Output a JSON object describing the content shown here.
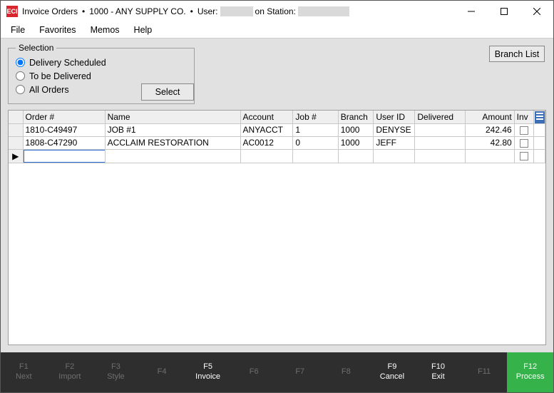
{
  "title": {
    "app_name": "Invoice Orders",
    "company": "1000 - ANY SUPPLY CO.",
    "user_prefix": "User:",
    "station_prefix": "on Station:"
  },
  "menu": {
    "file": "File",
    "favorites": "Favorites",
    "memos": "Memos",
    "help": "Help"
  },
  "selection": {
    "legend": "Selection",
    "opt_scheduled": "Delivery Scheduled",
    "opt_tobe": "To be Delivered",
    "opt_all": "All Orders",
    "select_btn": "Select"
  },
  "branch_btn": "Branch List",
  "columns": {
    "order": "Order #",
    "name": "Name",
    "account": "Account",
    "job": "Job #",
    "branch": "Branch",
    "user": "User ID",
    "delivered": "Delivered",
    "amount": "Amount",
    "inv": "Inv"
  },
  "rows": [
    {
      "order": "1810-C49497",
      "name": "JOB #1",
      "account": "ANYACCT",
      "job": "1",
      "branch": "1000",
      "user": "DENYSE",
      "delivered": "",
      "amount": "242.46"
    },
    {
      "order": "1808-C47290",
      "name": "ACCLAIM RESTORATION",
      "account": "AC0012",
      "job": "0",
      "branch": "1000",
      "user": "JEFF",
      "delivered": "",
      "amount": "42.80"
    }
  ],
  "fn": {
    "f1": {
      "k": "F1",
      "l": "Next"
    },
    "f2": {
      "k": "F2",
      "l": "Import"
    },
    "f3": {
      "k": "F3",
      "l": "Style"
    },
    "f4": {
      "k": "F4",
      "l": ""
    },
    "f5": {
      "k": "F5",
      "l": "Invoice"
    },
    "f6": {
      "k": "F6",
      "l": ""
    },
    "f7": {
      "k": "F7",
      "l": ""
    },
    "f8": {
      "k": "F8",
      "l": ""
    },
    "f9": {
      "k": "F9",
      "l": "Cancel"
    },
    "f10": {
      "k": "F10",
      "l": "Exit"
    },
    "f11": {
      "k": "F11",
      "l": ""
    },
    "f12": {
      "k": "F12",
      "l": "Process"
    }
  }
}
